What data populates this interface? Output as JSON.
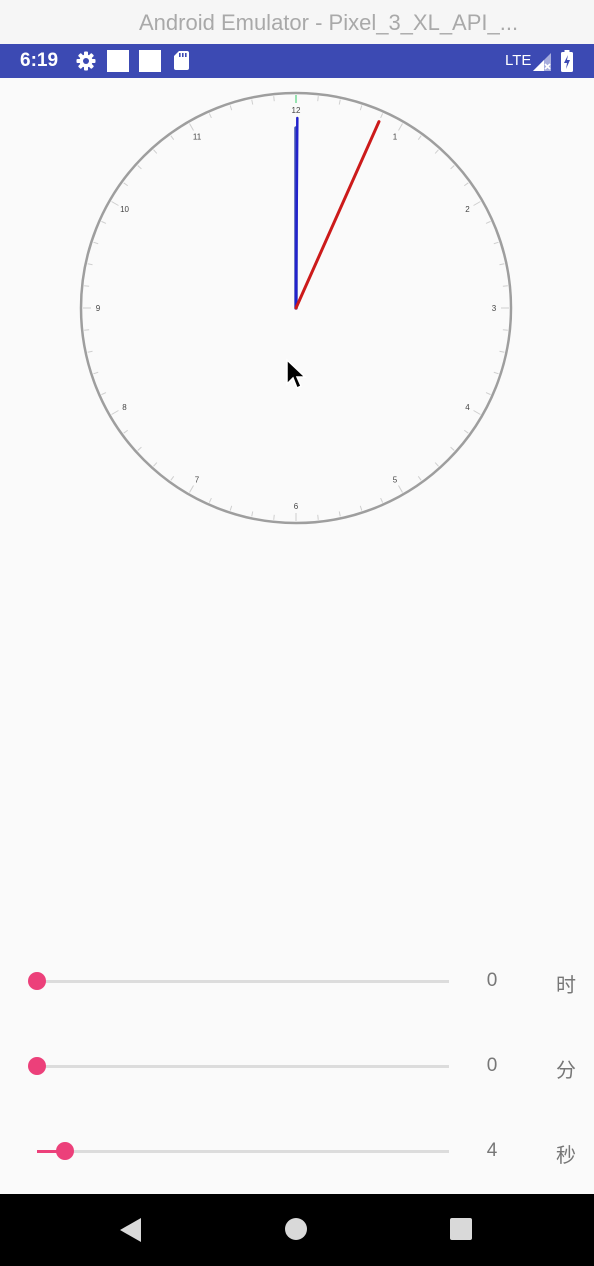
{
  "window": {
    "title": "Android Emulator - Pixel_3_XL_API_..."
  },
  "status_bar": {
    "time": "6:19",
    "network": "LTE",
    "icons": [
      "gear-icon",
      "notification-square-icon",
      "notification-square-icon",
      "sd-card-icon",
      "signal-icon",
      "battery-icon"
    ]
  },
  "clock": {
    "numbers": [
      "12",
      "1",
      "2",
      "3",
      "4",
      "5",
      "6",
      "7",
      "8",
      "9",
      "10",
      "11"
    ],
    "time": {
      "hour": 0,
      "minute": 0,
      "second": 4
    },
    "colors": {
      "face": "#9e9e9e",
      "hour_hand": "#3f51b5",
      "minute_hand": "#2222cc",
      "second_hand": "#cc1a1a",
      "twelve_mark": "#33cc66"
    }
  },
  "sliders": [
    {
      "id": "hour",
      "value": "0",
      "unit": "时",
      "max": 23
    },
    {
      "id": "minute",
      "value": "0",
      "unit": "分",
      "max": 59
    },
    {
      "id": "second",
      "value": "4",
      "unit": "秒",
      "max": 59
    }
  ],
  "colors": {
    "accent": "#ec407a",
    "status_bar": "#3c4ab3"
  },
  "nav_bar": {
    "icons": [
      "back-icon",
      "home-icon",
      "recents-icon"
    ]
  }
}
